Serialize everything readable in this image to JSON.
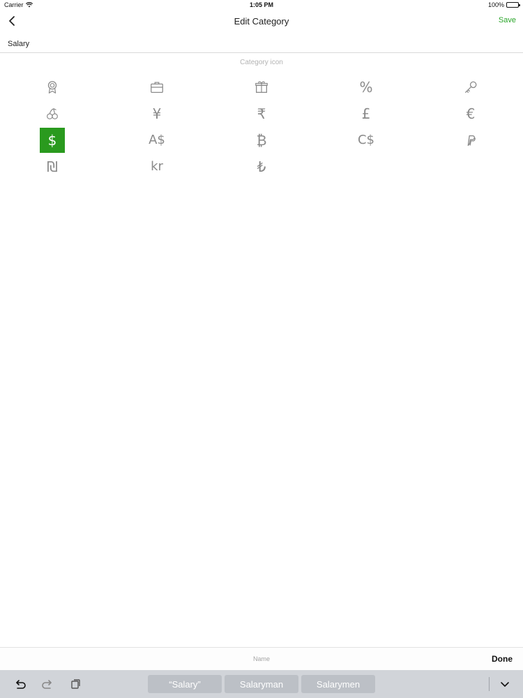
{
  "status_bar": {
    "carrier": "Carrier",
    "time": "1:05 PM",
    "battery": "100%"
  },
  "nav": {
    "title": "Edit Category",
    "save_label": "Save",
    "back_icon": "chevron-left-icon"
  },
  "name_field": {
    "value": "Salary"
  },
  "icon_section": {
    "label": "Category icon"
  },
  "icons": [
    {
      "name": "award-icon"
    },
    {
      "name": "briefcase-icon"
    },
    {
      "name": "gift-icon"
    },
    {
      "name": "percent-icon",
      "glyph": "%"
    },
    {
      "name": "key-icon"
    },
    {
      "name": "cherries-icon"
    },
    {
      "name": "yen-icon",
      "glyph": "¥"
    },
    {
      "name": "rupee-icon",
      "glyph": "₹"
    },
    {
      "name": "pound-icon",
      "glyph": "£"
    },
    {
      "name": "euro-icon",
      "glyph": "€"
    },
    {
      "name": "dollar-icon",
      "glyph": "$",
      "selected": true
    },
    {
      "name": "australian-dollar-icon",
      "glyph": "A$"
    },
    {
      "name": "bitcoin-icon",
      "glyph": "₿"
    },
    {
      "name": "canadian-dollar-icon",
      "glyph": "C$"
    },
    {
      "name": "paypal-icon"
    },
    {
      "name": "shekel-icon",
      "glyph": "₪"
    },
    {
      "name": "krona-icon",
      "glyph": "kr"
    },
    {
      "name": "lira-icon",
      "glyph": "₺"
    }
  ],
  "bottom_bar": {
    "field_label": "Name",
    "done_label": "Done"
  },
  "keyboard": {
    "suggestions": [
      "“Salary”",
      "Salaryman",
      "Salarymen"
    ],
    "undo_icon": "undo-icon",
    "redo_icon": "redo-icon",
    "paste_icon": "paste-icon",
    "dismiss_icon": "chevron-down-icon"
  },
  "colors": {
    "accent": "#2aa52a",
    "selected_icon_bg": "#2a9a1e",
    "icon_gray": "#8a8a8a",
    "keyboard_bg": "#d1d4d9"
  }
}
